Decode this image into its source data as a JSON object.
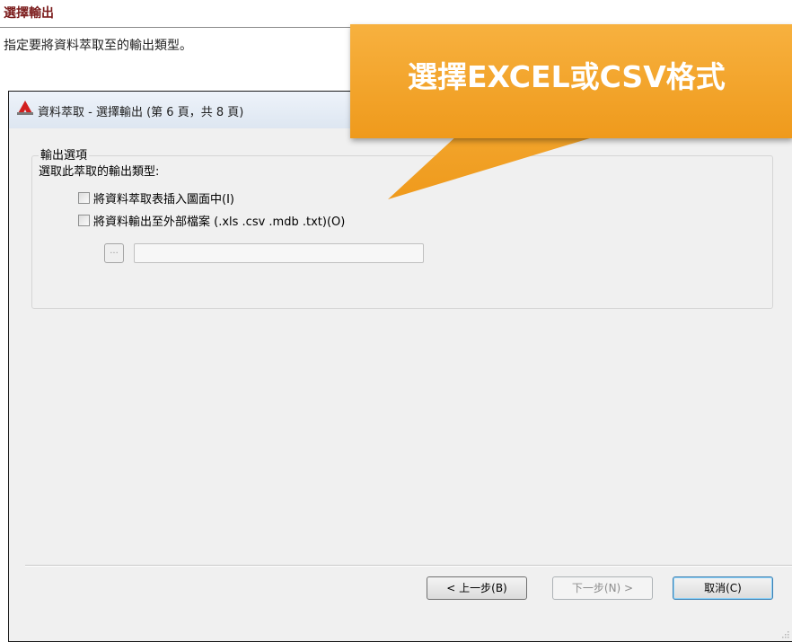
{
  "header": {
    "title": "選擇輸出",
    "description": "指定要將資料萃取至的輸出類型。"
  },
  "dialog": {
    "title": "資料萃取 - 選擇輸出 (第 6 頁，共 8 頁)",
    "group": {
      "legend": "輸出選項",
      "instruction": "選取此萃取的輸出類型:",
      "options": [
        {
          "label": "將資料萃取表插入圖面中(I)",
          "checked": false
        },
        {
          "label": "將資料輸出至外部檔案 (.xls .csv .mdb .txt)(O)",
          "checked": false
        }
      ],
      "browse_label": "...",
      "path_value": ""
    },
    "buttons": {
      "back": "< 上一步(B)",
      "next": "下一步(N) >",
      "cancel": "取消(C)"
    }
  },
  "callout": {
    "text": "選擇EXCEL或CSV格式",
    "color": "#f2a42b"
  },
  "colors": {
    "section_title": "#7b1b1b",
    "app_icon": "#d21f1f"
  }
}
